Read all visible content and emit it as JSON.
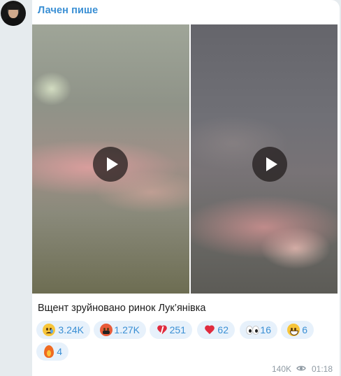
{
  "channel": {
    "name": "Лачен пише"
  },
  "media": [
    {
      "type": "video",
      "play_icon": "play-icon"
    },
    {
      "type": "video",
      "play_icon": "play-icon"
    }
  ],
  "caption": "Вщент зруйновано ринок Лук’янівка",
  "reactions": [
    {
      "emoji": "crying-face",
      "count": "3.24K"
    },
    {
      "emoji": "face-with-symbols-on-mouth",
      "count": "1.27K"
    },
    {
      "emoji": "broken-heart",
      "count": "251"
    },
    {
      "emoji": "red-heart",
      "count": "62"
    },
    {
      "emoji": "eyes",
      "count": "16"
    },
    {
      "emoji": "grinning-face",
      "count": "6"
    },
    {
      "emoji": "fire",
      "count": "4"
    }
  ],
  "footer": {
    "views": "140K",
    "views_icon": "eye-icon",
    "time": "01:18"
  },
  "colors": {
    "accent": "#3a8fd4",
    "reaction_bg": "#e7f1fb",
    "background": "#e6ebee",
    "bubble": "#ffffff"
  }
}
